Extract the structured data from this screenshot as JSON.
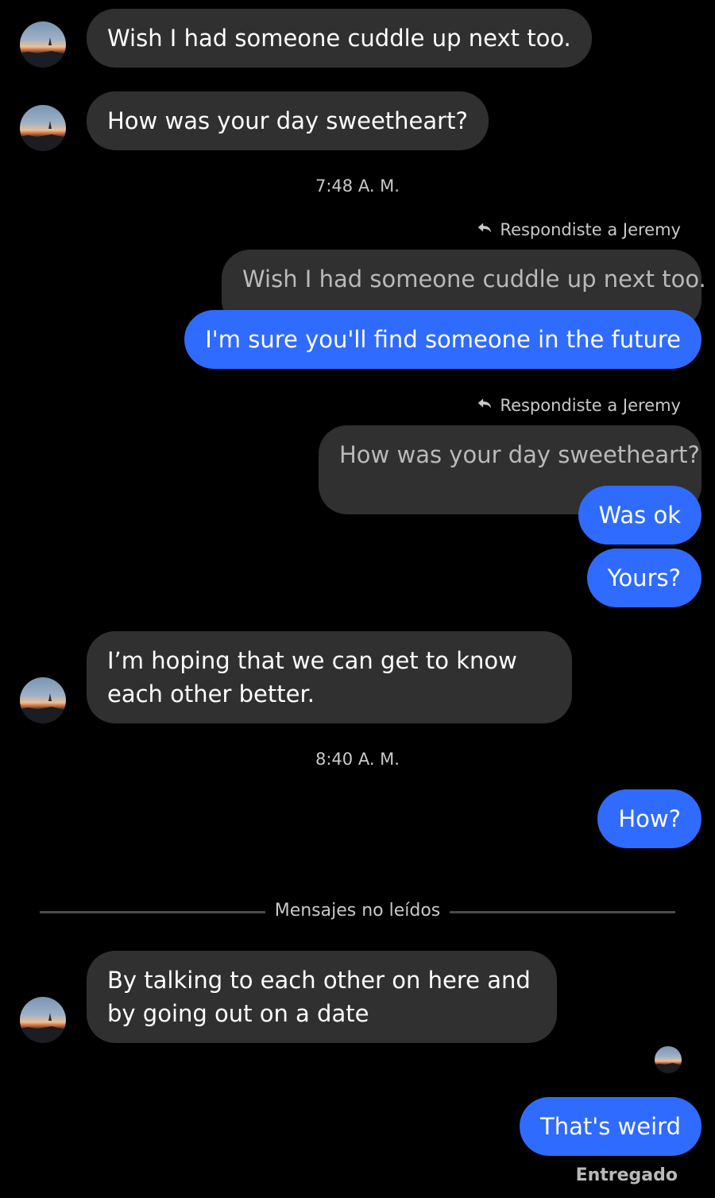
{
  "messages": {
    "m1": "Wish I had someone cuddle up next too.",
    "m2": "How was your day sweetheart?",
    "time1": "7:48 A. M.",
    "reply1_label": "Respondiste a Jeremy",
    "reply1_quote": "Wish I had someone cuddle up next too.",
    "reply1_text": "I'm sure you'll find someone in the future",
    "reply2_label": "Respondiste a Jeremy",
    "reply2_quote": "How was your day sweetheart?",
    "reply2_text": "Was ok",
    "out_yours": "Yours?",
    "m3": "I’m hoping that we can get to know each other better.",
    "time2": "8:40 A. M.",
    "out_how": "How?",
    "unread_label": "Mensajes no leídos",
    "m4": "By talking to each other on here and by going out on a date",
    "out_weird": "That's weird",
    "status": "Entregado"
  },
  "colors": {
    "background": "#000000",
    "incoming_bubble": "#303030",
    "outgoing_bubble": "#2f6bff",
    "muted_text": "#c9c9c9"
  },
  "icons": {
    "avatar": "sunset-avatar-icon",
    "reply": "reply-arrow-icon"
  }
}
